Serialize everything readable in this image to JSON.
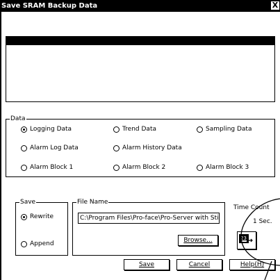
{
  "window": {
    "title": "Save SRAM Backup Data",
    "close_glyph": "X"
  },
  "data_group": {
    "legend": "Data",
    "options": [
      {
        "label": "Logging Data",
        "checked": true
      },
      {
        "label": "Trend Data",
        "checked": false
      },
      {
        "label": "Sampling Data",
        "checked": false
      },
      {
        "label": "Alarm Log Data",
        "checked": false
      },
      {
        "label": "Alarm History Data",
        "checked": false
      },
      {
        "label": "Alarm Block 1",
        "checked": false
      },
      {
        "label": "Alarm Block 2",
        "checked": false
      },
      {
        "label": "Alarm Block 3",
        "checked": false
      }
    ]
  },
  "save_group": {
    "legend": "Save",
    "options": [
      {
        "label": "Rewrite",
        "checked": true
      },
      {
        "label": "Append",
        "checked": false
      }
    ]
  },
  "file_group": {
    "legend": "File Name",
    "path_value": "C:\\Program Files\\Pro-face\\Pro-Server with Sti",
    "browse_label": "Browse..."
  },
  "time_count": {
    "label": "Time Count",
    "value": "1 Sec.",
    "icon_text": "23"
  },
  "buttons": {
    "save": "Save",
    "cancel": "Cancel",
    "help": "Help(H)"
  }
}
